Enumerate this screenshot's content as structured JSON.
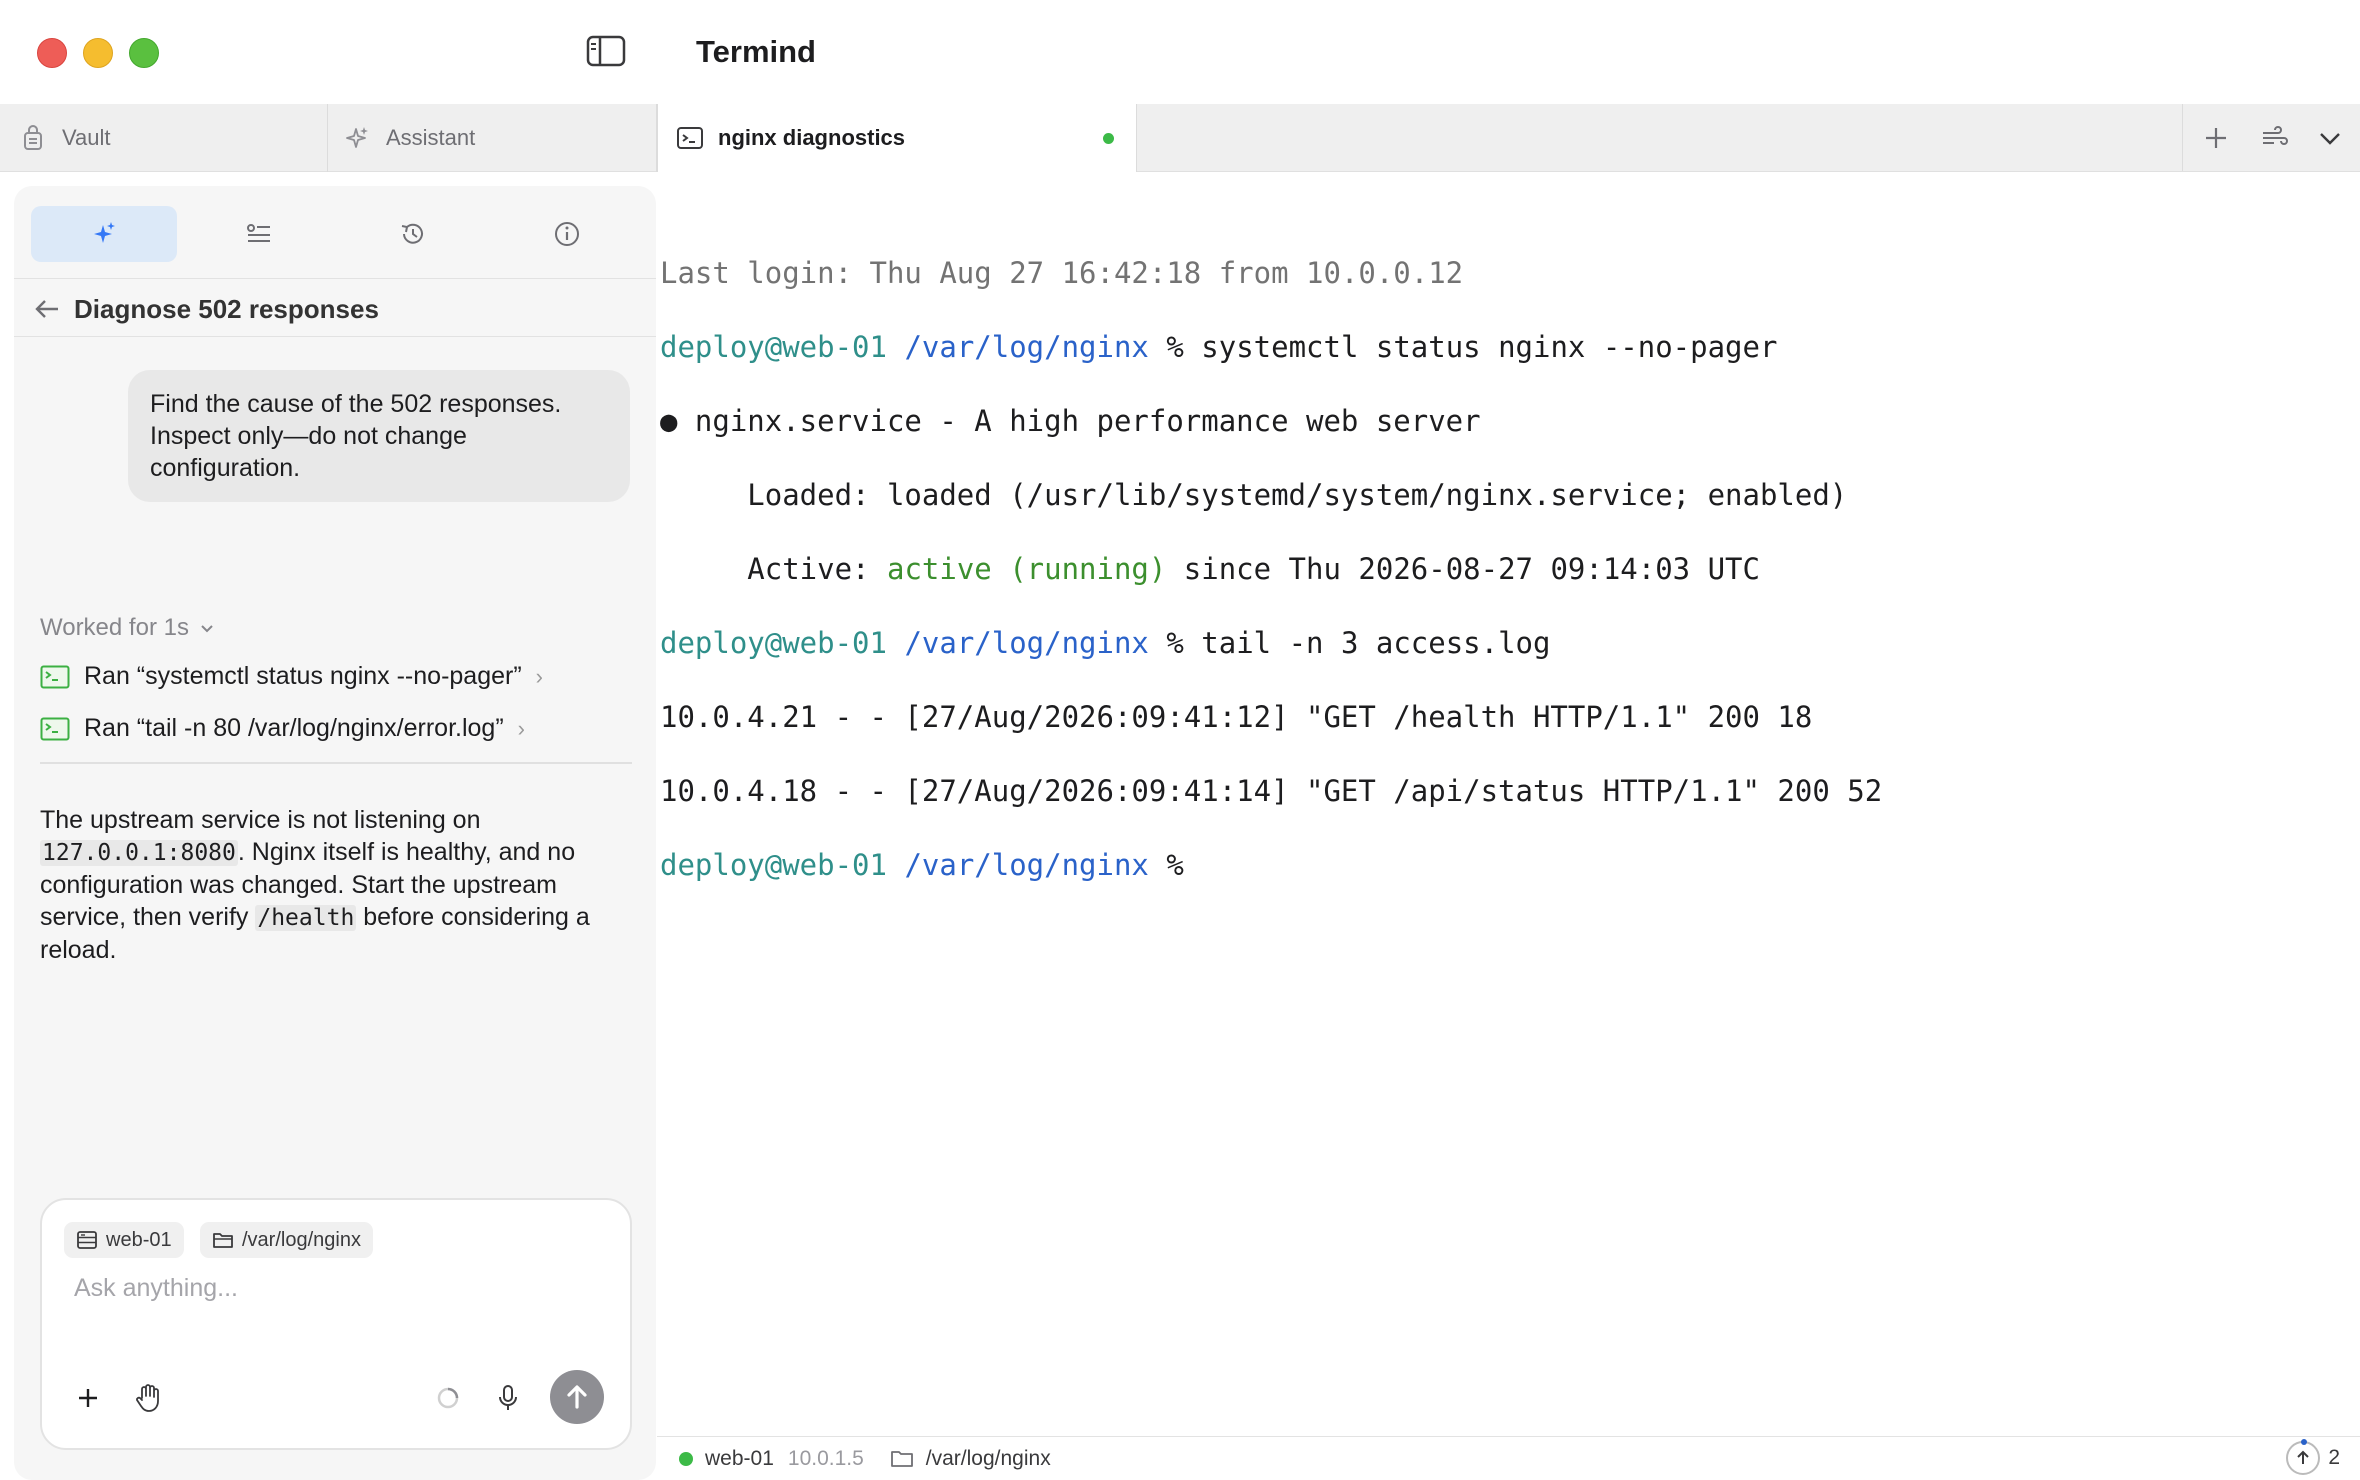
{
  "window": {
    "title": "Termind"
  },
  "tabs": [
    {
      "label": "Vault",
      "icon": "vault-icon"
    },
    {
      "label": "Assistant",
      "icon": "sparkle-icon"
    },
    {
      "label": "nginx diagnostics",
      "icon": "terminal-icon",
      "active": true,
      "status_color": "#3cba47"
    }
  ],
  "panel": {
    "tabs": [
      "sparkle-icon",
      "list-icon",
      "history-icon",
      "info-icon"
    ],
    "conversation_title": "Diagnose 502 responses",
    "user_message": "Find the cause of the 502 responses. Inspect only—do not change configuration.",
    "worked_label": "Worked for 1s",
    "ran": [
      "Ran “systemctl status nginx --no-pager”",
      "Ran “tail -n 80 /var/log/nginx/error.log”"
    ],
    "answer": {
      "p1": "The upstream service is not listening on ",
      "code1": "127.0.0.1:8080",
      "p2": ". Nginx itself is healthy, and no configuration was changed. Start the upstream service, then verify ",
      "code2": "/health",
      "p3": " before considering a reload."
    },
    "composer": {
      "chip_host": "web-01",
      "chip_path": "/var/log/nginx",
      "placeholder": "Ask anything..."
    }
  },
  "terminal": {
    "last_login": "Last login: Thu Aug 27 16:42:18 from 10.0.0.12",
    "prompt_user": "deploy@web-01",
    "prompt_path": "/var/log/nginx",
    "cmd1": " % systemctl status nginx --no-pager",
    "service_line": "● nginx.service - A high performance web server",
    "loaded_line": "     Loaded: loaded (/usr/lib/systemd/system/nginx.service; enabled)",
    "active_prefix": "     Active: ",
    "active_state": "active (running)",
    "active_suffix": " since Thu 2026-08-27 09:14:03 UTC",
    "cmd2": " % tail -n 3 access.log",
    "log1": "10.0.4.21 - - [27/Aug/2026:09:41:12] \"GET /health HTTP/1.1\" 200 18",
    "log2": "10.0.4.18 - - [27/Aug/2026:09:41:14] \"GET /api/status HTTP/1.1\" 200 52",
    "cmd3": " %"
  },
  "statusbar": {
    "host": "web-01",
    "ip": "10.0.1.5",
    "path": "/var/log/nginx",
    "count": "2"
  },
  "colors": {
    "accent": "#2a62c9",
    "prompt_user": "#2f8f8a",
    "active_green": "#3c8f2e",
    "status_green": "#3cba47"
  }
}
